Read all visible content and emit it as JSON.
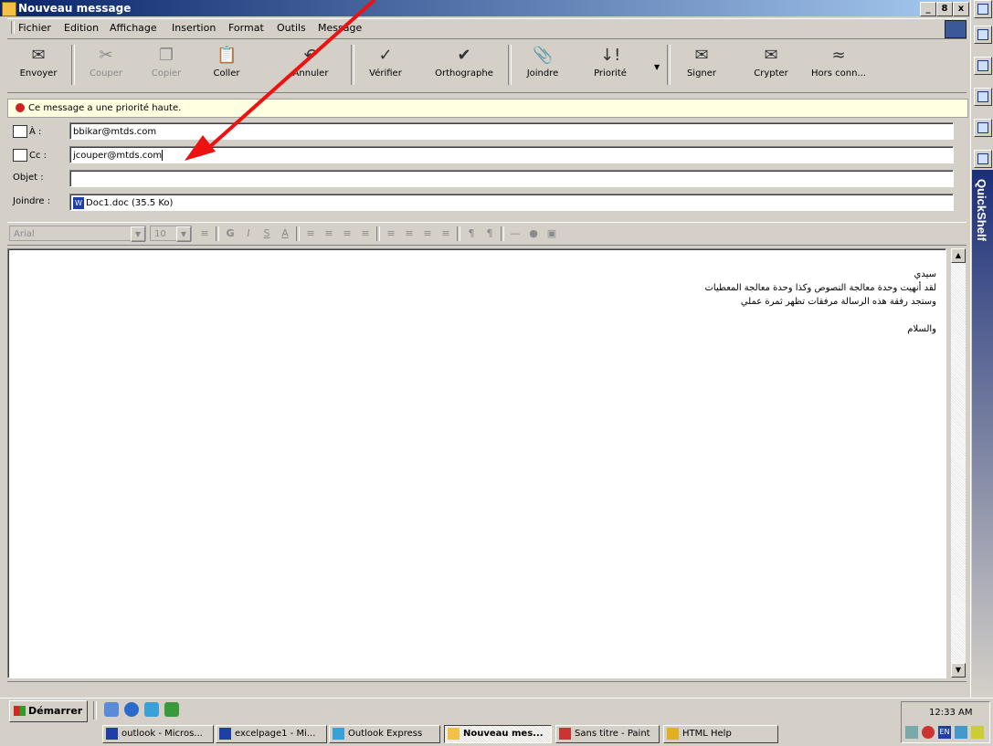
{
  "window": {
    "title": "Nouveau message",
    "controls": [
      "_",
      "8",
      "x"
    ]
  },
  "menu": [
    "Fichier",
    "Edition",
    "Affichage",
    "Insertion",
    "Format",
    "Outils",
    "Message"
  ],
  "toolbar": [
    {
      "label": "Envoyer",
      "icon": "send-icon",
      "enabled": true
    },
    {
      "label": "Couper",
      "icon": "scissors-icon",
      "enabled": false
    },
    {
      "label": "Copier",
      "icon": "copy-icon",
      "enabled": false
    },
    {
      "label": "Coller",
      "icon": "paste-icon",
      "enabled": true
    },
    {
      "label": "Annuler",
      "icon": "undo-icon",
      "enabled": true
    },
    {
      "label": "Vérifier",
      "icon": "check-names-icon",
      "enabled": true
    },
    {
      "label": "Orthographe",
      "icon": "spelling-icon",
      "enabled": true
    },
    {
      "label": "Joindre",
      "icon": "paperclip-icon",
      "enabled": true
    },
    {
      "label": "Priorité",
      "icon": "priority-icon",
      "enabled": true
    },
    {
      "label": "Signer",
      "icon": "sign-icon",
      "enabled": true
    },
    {
      "label": "Crypter",
      "icon": "encrypt-icon",
      "enabled": true
    },
    {
      "label": "Hors conn...",
      "icon": "offline-icon",
      "enabled": true
    }
  ],
  "infobar": {
    "text": "Ce message a une priorité haute."
  },
  "fields": {
    "to_label": "À :",
    "to_value": "bbikar@mtds.com",
    "cc_label": "Cc :",
    "cc_value": "jcouper@mtds.com",
    "subject_label": "Objet :",
    "subject_value": "",
    "attach_label": "Joindre :",
    "attach_value": "Doc1.doc (35.5 Ko)"
  },
  "format": {
    "font": "Arial",
    "size": "10"
  },
  "body_lines": [
    "سيدي",
    "لقد أنهيت وحدة معالجة النصوص وكذا وحدة معالجة المعطيات",
    "وستجد رفقة هذه الرسالة مرفقات تظهر ثمرة عملي",
    "",
    "والسلام"
  ],
  "sidebar": {
    "label": "QuickShelf"
  },
  "taskbar": {
    "start": "Démarrer",
    "tasks": [
      {
        "label": "outlook - Micros...",
        "active": false
      },
      {
        "label": "excelpage1 - Mi...",
        "active": false
      },
      {
        "label": "Outlook Express",
        "active": false
      },
      {
        "label": "Nouveau mes...",
        "active": true
      },
      {
        "label": "Sans titre - Paint",
        "active": false
      },
      {
        "label": "HTML Help",
        "active": false
      }
    ],
    "clock": "12:33 AM",
    "lang": "EN"
  },
  "colors": {
    "title_start": "#0a246a",
    "title_end": "#a6caf0",
    "arrow": "#ee1111",
    "info_bg": "#ffffe1"
  }
}
